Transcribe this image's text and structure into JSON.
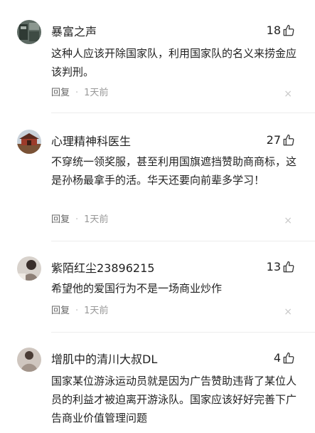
{
  "comments": [
    {
      "user": "暴富之声",
      "likes": "18",
      "text": "这种人应该开除国家队，利用国家队的名义来捞金应该判刑。",
      "reply_label": "回复",
      "separator": "·",
      "time": "1天前",
      "close_glyph": "×"
    },
    {
      "user": "心理精神科医生",
      "likes": "27",
      "text": "不穿统一领奖服，甚至利用国旗遮挡赞助商商标，这是孙杨最拿手的活。华天还要向前辈多学习！",
      "reply_label": "回复",
      "separator": "·",
      "time": "1天前",
      "close_glyph": "×"
    },
    {
      "user": "紫陌红尘23896215",
      "likes": "13",
      "text": "希望他的爱国行为不是一场商业炒作",
      "reply_label": "回复",
      "separator": "·",
      "time": "1天前",
      "close_glyph": "×"
    },
    {
      "user": "增肌中的清川大叔DL",
      "likes": "4",
      "text": "国家某位游泳运动员就是因为广告赞助违背了某位人员的利益才被迫离开游泳队。国家应该好好完善下广告商业价值管理问题",
      "reply_label": "",
      "separator": "",
      "time": "",
      "close_glyph": ""
    }
  ],
  "icons": {
    "like": "thumbs-up-icon",
    "close": "close-icon"
  },
  "colors": {
    "text": "#222222",
    "meta": "#666666",
    "time": "#999999",
    "close": "#c8c8c8",
    "divider": "#ececec"
  }
}
